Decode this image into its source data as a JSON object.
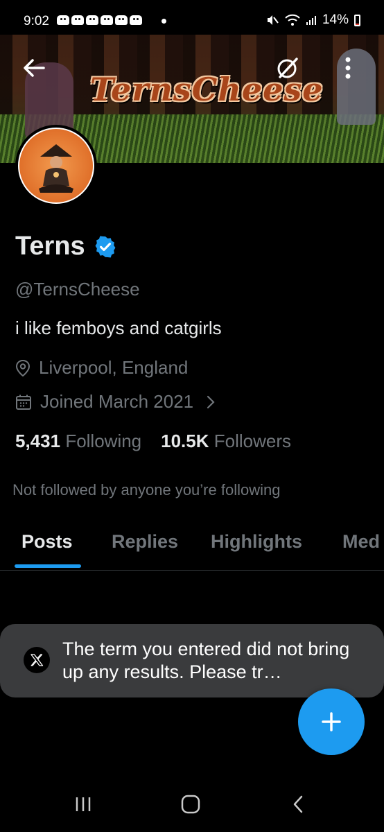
{
  "status_bar": {
    "time": "9:02",
    "battery": "14%",
    "battery_level": 0.14
  },
  "header": {
    "banner_text": "TernsCheese"
  },
  "profile": {
    "name": "Terns",
    "handle": "@TernsCheese",
    "bio": "i like femboys and catgirls",
    "location": "Liverpool, England",
    "joined": "Joined March 2021",
    "following_count": "5,431",
    "following_label": "Following",
    "followers_count": "10.5K",
    "followers_label": "Followers",
    "mutuals_note": "Not followed by anyone you’re following"
  },
  "tabs": [
    {
      "label": "Posts",
      "active": true
    },
    {
      "label": "Replies",
      "active": false
    },
    {
      "label": "Highlights",
      "active": false
    },
    {
      "label": "Med",
      "active": false
    }
  ],
  "toast": {
    "message": "The term you entered did not bring up any results. Please tr…"
  },
  "colors": {
    "accent": "#1d9bf0",
    "background": "#000000",
    "secondary_text": "#71767b",
    "toast_bg": "#3a3b3d"
  },
  "icons": [
    "back-arrow-icon",
    "grok-icon",
    "more-vertical-icon",
    "verified-badge-icon",
    "location-pin-icon",
    "calendar-icon",
    "chevron-right-icon",
    "x-logo-icon",
    "plus-icon",
    "recent-apps-icon",
    "home-icon",
    "back-icon"
  ]
}
